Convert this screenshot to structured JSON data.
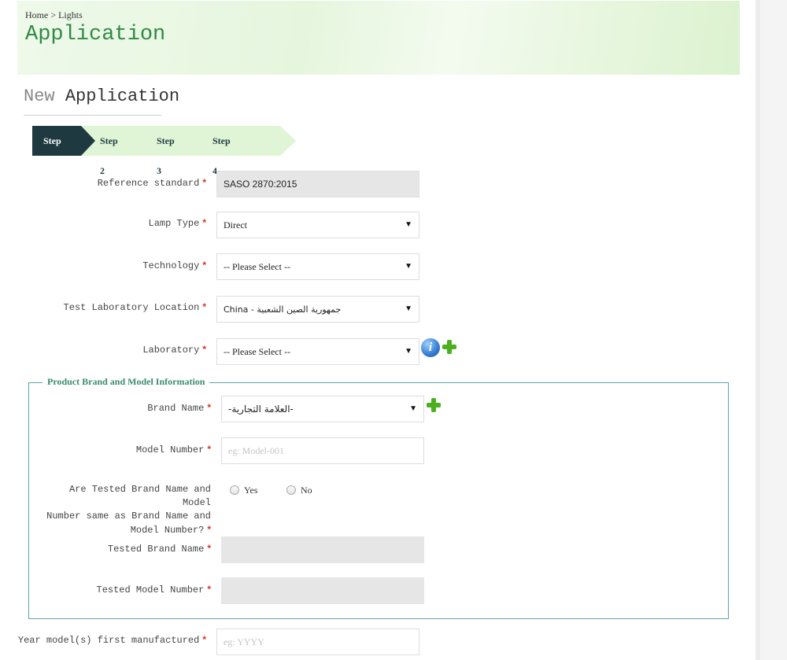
{
  "breadcrumb": "Home > Lights",
  "page_title": "Application",
  "section_title": {
    "light": "New",
    "dark": "Application"
  },
  "steps": [
    "Step 1",
    "Step 2",
    "Step 3",
    "Step 4"
  ],
  "form": {
    "reference_standard": {
      "label": "Reference standard",
      "value": "SASO 2870:2015"
    },
    "lamp_type": {
      "label": "Lamp Type",
      "value": "Direct"
    },
    "technology": {
      "label": "Technology",
      "value": "-- Please Select --"
    },
    "test_lab_location": {
      "label": "Test Laboratory Location",
      "value": "China - جمهورية الصين الشعبية"
    },
    "laboratory": {
      "label": "Laboratory",
      "value": "-- Please Select --"
    }
  },
  "brand_section": {
    "legend": "Product Brand and Model Information",
    "brand_name": {
      "label": "Brand Name",
      "value": "-العلامة التجارية-"
    },
    "model_number": {
      "label": "Model Number",
      "placeholder": "eg: Model-001"
    },
    "same_question": {
      "line1": "Are Tested Brand Name and Model",
      "line2": "Number same as Brand Name and",
      "line3": "Model Number?",
      "yes": "Yes",
      "no": "No"
    },
    "tested_brand_name": {
      "label": "Tested Brand Name"
    },
    "tested_model_number": {
      "label": "Tested Model Number"
    }
  },
  "year_manufactured": {
    "label": "Year model(s) first manufactured",
    "placeholder": "eg: YYYY"
  },
  "required_mark": "*",
  "colors": {
    "accent_green": "#2f8a43",
    "step_active": "#1e3a40",
    "step_inactive": "#dff5d6",
    "required": "#d9311f"
  },
  "icons": {
    "info": "info-icon",
    "add": "plus-icon",
    "dropdown": "caret-down-icon"
  }
}
